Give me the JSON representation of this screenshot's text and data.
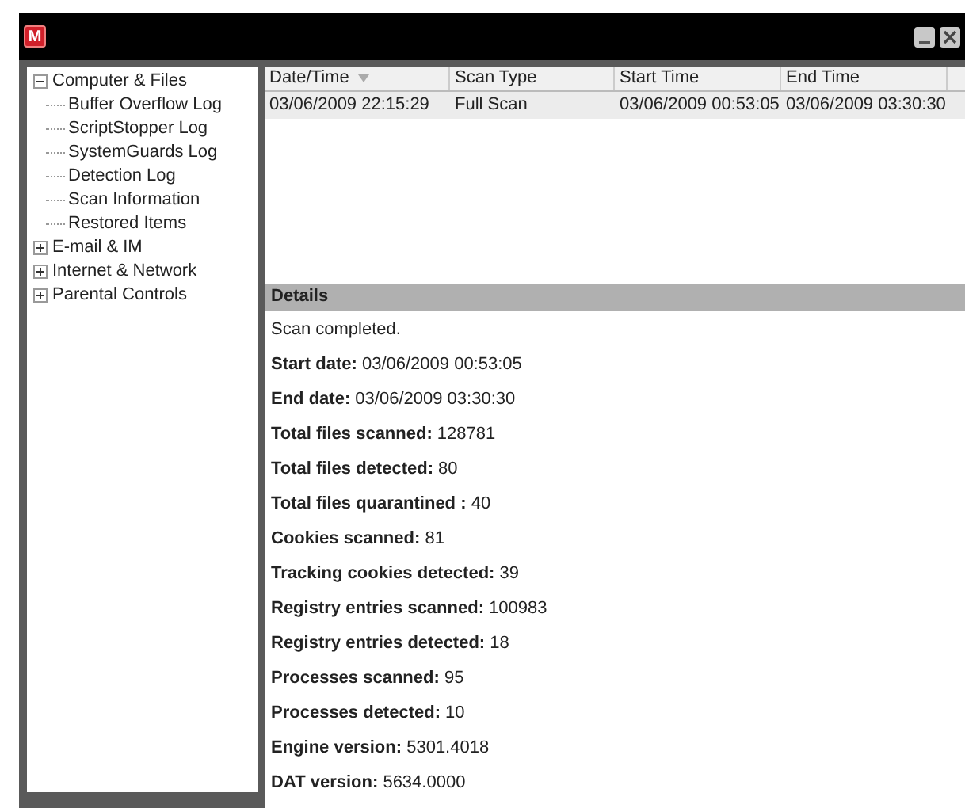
{
  "window": {
    "logo": "M",
    "buttons": [
      {
        "kind": "minimize"
      },
      {
        "kind": "close"
      }
    ]
  },
  "tree": [
    {
      "label": "Computer & Files",
      "expanded": true,
      "children": [
        {
          "label": "Buffer Overflow Log"
        },
        {
          "label": "ScriptStopper Log"
        },
        {
          "label": "SystemGuards Log"
        },
        {
          "label": "Detection Log"
        },
        {
          "label": "Scan Information"
        },
        {
          "label": "Restored Items"
        }
      ]
    },
    {
      "label": "E-mail & IM",
      "expanded": false
    },
    {
      "label": "Internet & Network",
      "expanded": false
    },
    {
      "label": "Parental Controls",
      "expanded": false
    }
  ],
  "table": {
    "columns": [
      {
        "label": "Date/Time",
        "sorted": true
      },
      {
        "label": "Scan Type",
        "sorted": false
      },
      {
        "label": "Start Time",
        "sorted": false
      },
      {
        "label": "End Time",
        "sorted": false
      }
    ],
    "rows": [
      {
        "selected": true,
        "cells": [
          "03/06/2009 22:15:29",
          "Full Scan",
          "03/06/2009 00:53:05",
          "03/06/2009 03:30:30"
        ]
      }
    ]
  },
  "details": {
    "title": "Details",
    "lines": [
      "Scan completed.",
      "**Start date:** 03/06/2009 00:53:05",
      "**End date:** 03/06/2009 03:30:30",
      "**Total files scanned:** 128781",
      "**Total files detected:** 80",
      "**Total files quarantined :** 40",
      "**Cookies scanned:** 81",
      "**Tracking cookies detected:** 39",
      "**Registry entries scanned:** 100983",
      "**Registry entries detected:** 18",
      "**Processes scanned:** 95",
      "**Processes detected:** 10",
      "**Engine version:** 5301.4018",
      "**DAT version:** 5634.0000"
    ]
  }
}
